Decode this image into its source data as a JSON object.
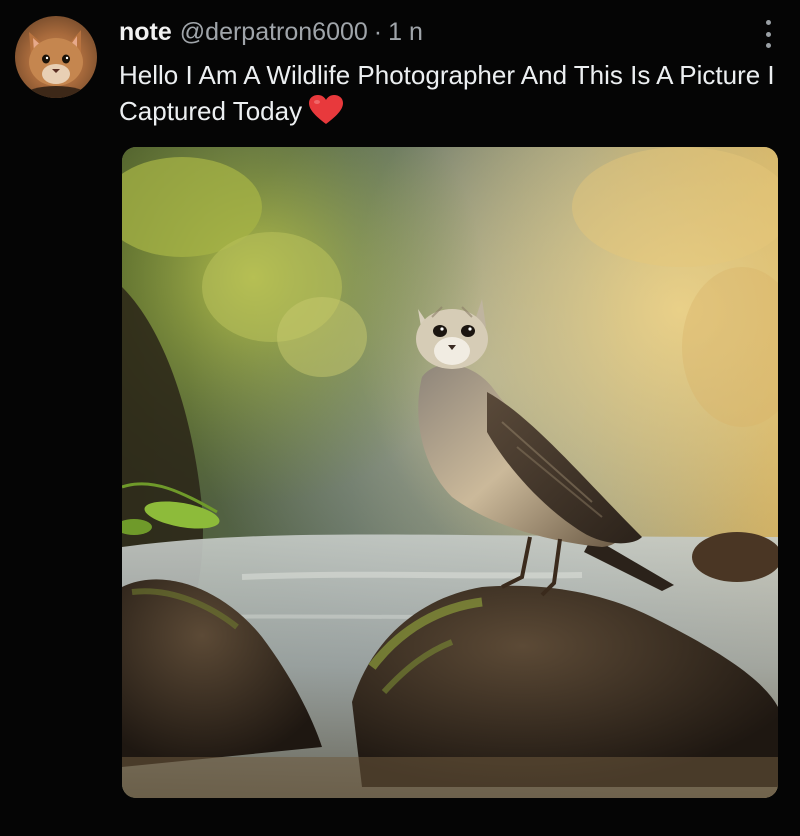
{
  "post": {
    "display_name": "note",
    "handle": "@derpatron6000",
    "separator": "·",
    "timestamp": "1 n",
    "text": "Hello I Am A Wildlife Photographer And This Is A Picture I Captured Today",
    "emoji_icon": "red-heart-icon",
    "more_icon": "more-options-icon",
    "avatar_icon": "cat-avatar"
  },
  "colors": {
    "background": "#050505",
    "text_primary": "#eceff1",
    "text_secondary": "#a0a5aa",
    "heart": "#e8393c"
  }
}
